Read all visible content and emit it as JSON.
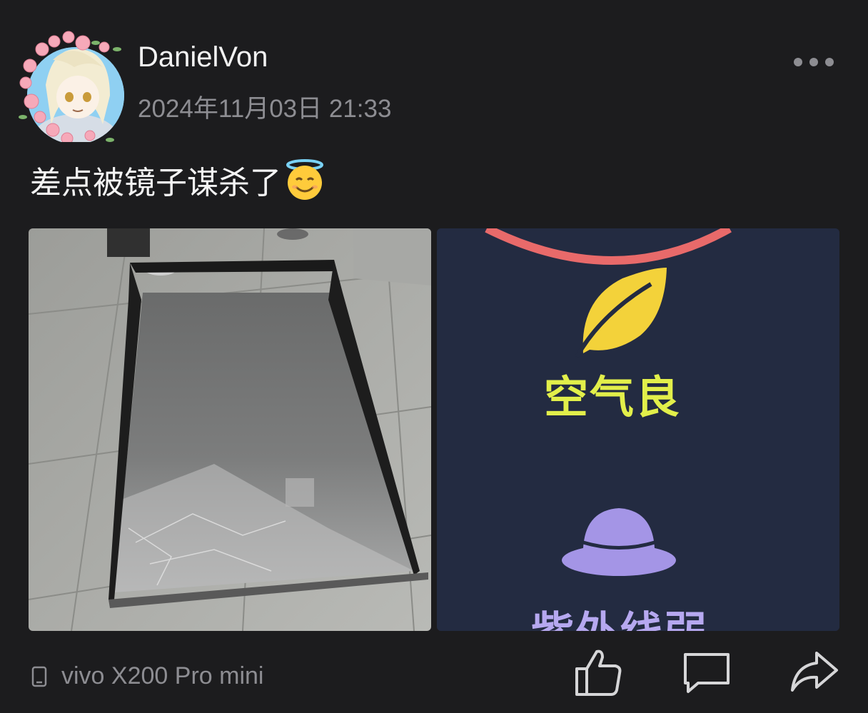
{
  "post": {
    "username": "DanielVon",
    "timestamp": "2024年11月03日 21:33",
    "text": "差点被镜子谋杀了",
    "emoji": "smiling-face-with-halo",
    "device": "vivo X200 Pro mini"
  },
  "right_image": {
    "line1": "空气良",
    "line2": "紫外线弱"
  },
  "colors": {
    "background": "#1c1c1e",
    "secondary_text": "#8d8d92",
    "leaf_yellow": "#f3d23a",
    "label_lime": "#e2ef4a",
    "hat_purple": "#a495e6"
  }
}
